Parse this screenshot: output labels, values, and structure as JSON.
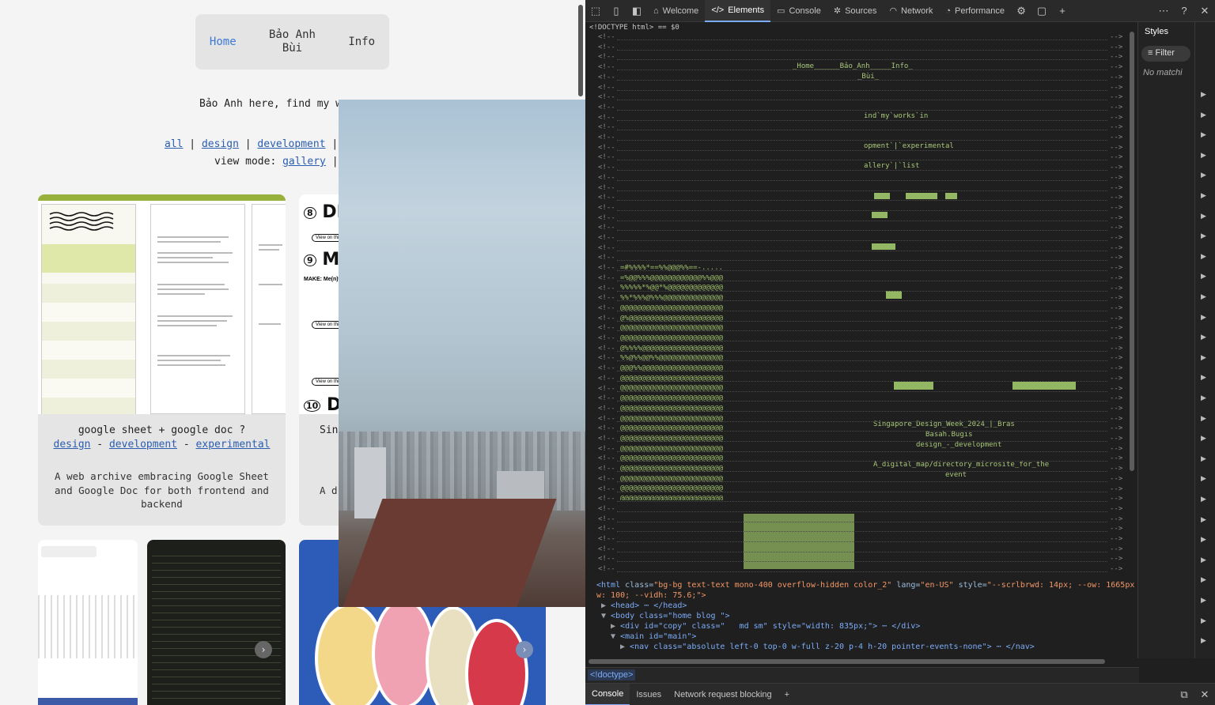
{
  "site": {
    "nav": {
      "home": "Home",
      "name_line1": "Bảo  Anh",
      "name_line2": "Bùi",
      "info": "Info"
    },
    "intro": "Bảo Anh here, find my w",
    "filters": {
      "all": "all",
      "sep": " | ",
      "design": "design",
      "development": "development",
      "trailing": " |",
      "view_mode_label": "view mode: ",
      "gallery": "gallery",
      "trailing2": " |"
    },
    "cards": [
      {
        "title": "google sheet + google doc ?",
        "tag1": "design",
        "tag2": "development",
        "tag3": "experimental",
        "dash": " - ",
        "desc": "A web archive embracing Google Sheet and Google Doc for both frontend and backend"
      },
      {
        "title": "Sin",
        "desc": "A d"
      }
    ],
    "thumb_texts": {
      "di": "DI",
      "mai": "MAI",
      "des": "DES",
      "n8": "8",
      "n9": "9",
      "n10": "10",
      "make": "MAKE: Me(n)tal",
      "view": "View on this"
    }
  },
  "devtools": {
    "tabs": [
      {
        "label": "Welcome",
        "icon": "home-icon"
      },
      {
        "label": "Elements",
        "icon": "code-icon"
      },
      {
        "label": "Console",
        "icon": "console-icon"
      },
      {
        "label": "Sources",
        "icon": "bug-icon"
      },
      {
        "label": "Network",
        "icon": "wifi-icon"
      },
      {
        "label": "Performance",
        "icon": "performance-icon"
      }
    ],
    "doctype_line": "<!DOCTYPE html> == $0",
    "ascii": {
      "nav": "_Home______Bảo_Anh_____Info_",
      "nav2": "_Bùi_",
      "intro": "ind`my`works`in",
      "filters": "opment`|`experimental",
      "view": "allery`|`list",
      "card_title": "Singapore_Design_Week_2024_|_Bras",
      "card_title2": "Basah.Bugis",
      "card_tags": "design_-_development",
      "card_desc": "A_digital_map/directory_microsite_for_the",
      "card_desc2": "event"
    },
    "html_tag": {
      "tag": "<html",
      "class_attr": " class=",
      "class_val": "\"bg-bg text-text mono-400 overflow-hidden color_2\"",
      "lang_attr": " lang=",
      "lang_val": "\"en-US\"",
      "style_attr": " style=",
      "style_val": "\"--scrlbrwd: 14px; --ow: 1665px; --vid",
      "line2": "w: 100; --vidh: 75.6;\">"
    },
    "head_line": "<head> ⋯ </head>",
    "body_line": "<body class=\"home blog \">",
    "div_line": "<div id=\"copy\" class=\"   md sm\" style=\"width: 835px;\"> ⋯ </div>",
    "main_line": "<main id=\"main\">",
    "nav_line": "<nav class=\"absolute left-0 top-0 w-full z-20 p-4 h-20 pointer-events-none\"> ⋯ </nav>",
    "styles": {
      "tab": "Styles",
      "filter": "Filter",
      "no_match": "No matchi"
    },
    "breadcrumb": "<!doctype>",
    "drawer": {
      "console": "Console",
      "issues": "Issues",
      "blocking": "Network request blocking"
    }
  }
}
